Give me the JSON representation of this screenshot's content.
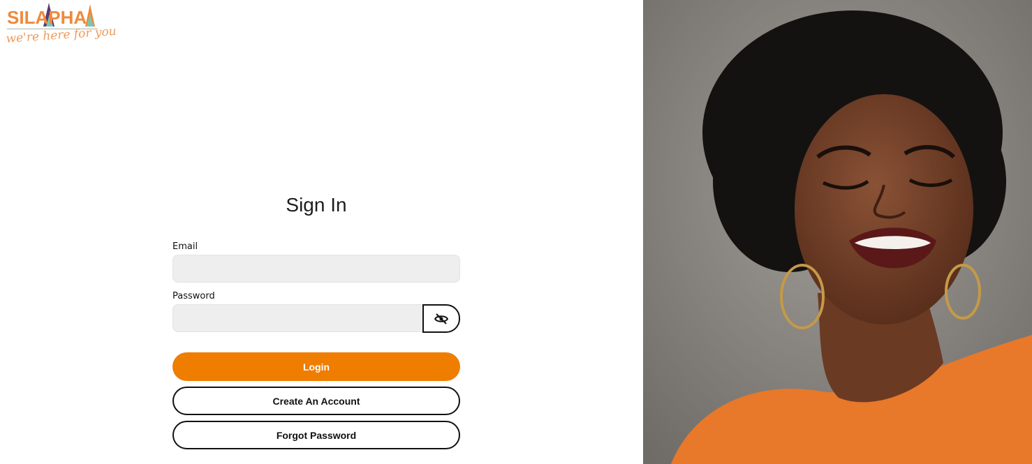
{
  "brand": {
    "wordmark": "SILAPHA",
    "tagline": "we're here for you",
    "colors": {
      "orange": "#ef8a3c",
      "purple": "#5b3a6e",
      "teal": "#7fc4b0"
    }
  },
  "form": {
    "title": "Sign In",
    "email": {
      "label": "Email",
      "value": "",
      "placeholder": ""
    },
    "password": {
      "label": "Password",
      "value": "",
      "placeholder": "",
      "toggle_icon": "eye-slash-icon"
    },
    "buttons": {
      "login": "Login",
      "create_account": "Create An Account",
      "forgot_password": "Forgot Password"
    }
  },
  "hero_image": {
    "subject": "smiling woman with curly hair and hoop earrings in orange top",
    "background": "#8a8680"
  },
  "colors": {
    "accent": "#ef7d00",
    "input_bg": "#eeeeee"
  }
}
